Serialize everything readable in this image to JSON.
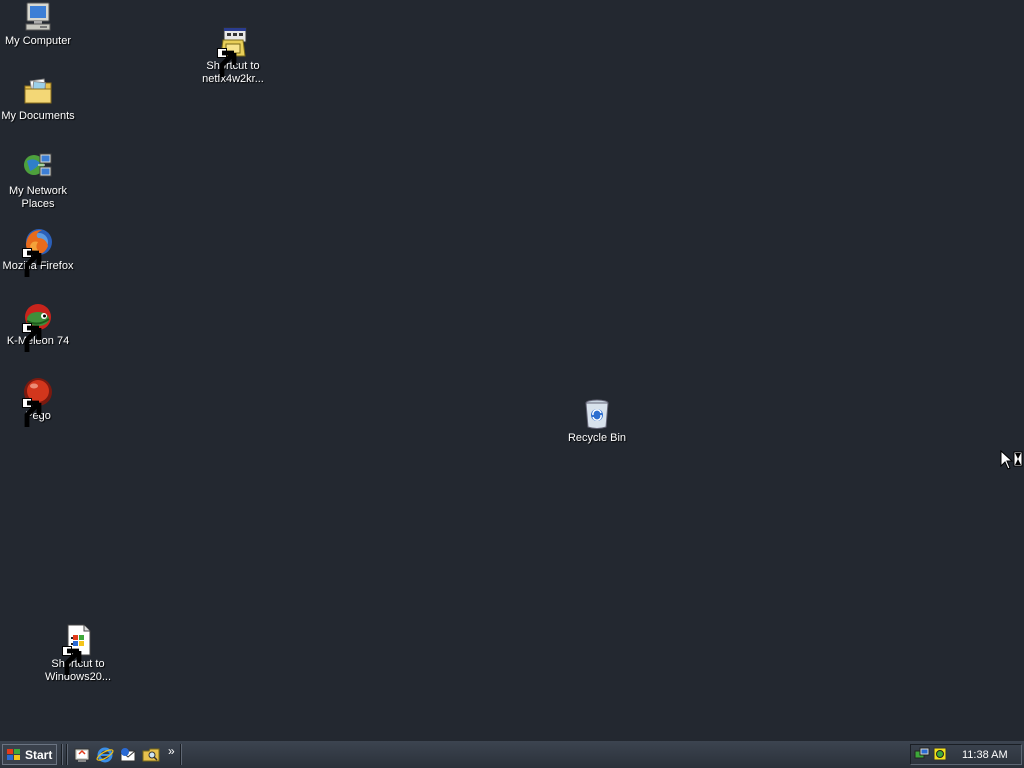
{
  "desktop": {
    "background_color": "#232830",
    "icons": [
      {
        "name": "my-computer",
        "label": "My Computer",
        "icon": "computer-icon",
        "shortcut": false
      },
      {
        "name": "my-documents",
        "label": "My Documents",
        "icon": "folder-documents-icon",
        "shortcut": false
      },
      {
        "name": "my-network-places",
        "label": "My Network Places",
        "icon": "network-icon",
        "shortcut": false
      },
      {
        "name": "mozilla-firefox",
        "label": "Mozilla Firefox",
        "icon": "firefox-icon",
        "shortcut": true
      },
      {
        "name": "k-meleon",
        "label": "K-Meleon 74",
        "icon": "k-meleon-icon",
        "shortcut": true
      },
      {
        "name": "pego",
        "label": "Pego",
        "icon": "pego-icon",
        "shortcut": true
      },
      {
        "name": "shortcut-netfx",
        "label": "Shortcut to netfx4w2kr...",
        "icon": "installer-icon",
        "shortcut": true
      },
      {
        "name": "recycle-bin",
        "label": "Recycle Bin",
        "icon": "recycle-bin-icon",
        "shortcut": false
      },
      {
        "name": "shortcut-windows20",
        "label": "Shortcut to Windows20...",
        "icon": "windows-document-icon",
        "shortcut": true
      }
    ]
  },
  "taskbar": {
    "start_label": "Start",
    "quick_launch": [
      {
        "name": "show-desktop",
        "icon": "show-desktop-icon"
      },
      {
        "name": "internet-explorer",
        "icon": "internet-explorer-icon"
      },
      {
        "name": "outlook-express",
        "icon": "outlook-express-icon"
      },
      {
        "name": "windows-explorer",
        "icon": "explorer-search-icon"
      }
    ],
    "overflow_label": "»",
    "tray_icons": [
      {
        "name": "network-tray",
        "icon": "network-tray-icon"
      },
      {
        "name": "security-tray",
        "icon": "security-tray-icon"
      }
    ],
    "clock": "11:38 AM"
  }
}
